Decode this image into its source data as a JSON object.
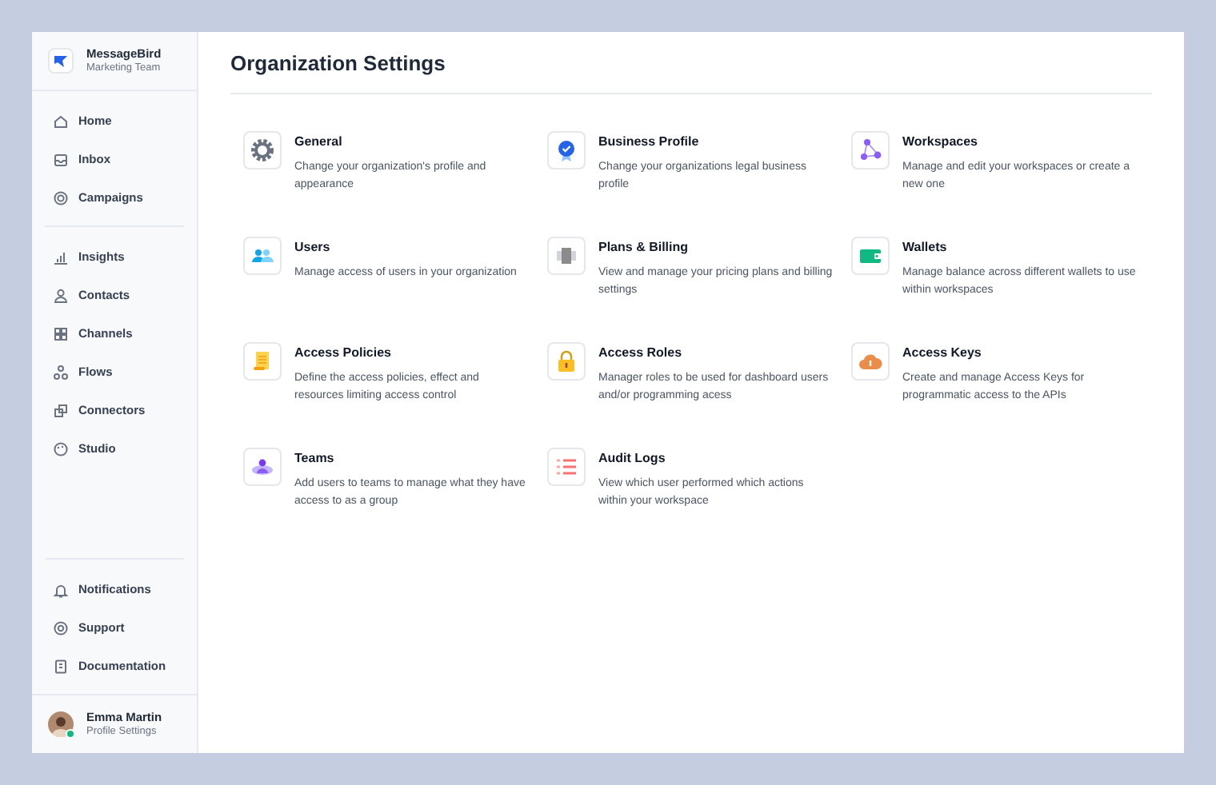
{
  "brand": {
    "name": "MessageBird",
    "team": "Marketing Team"
  },
  "nav_groups": [
    {
      "items": [
        {
          "label": "Home",
          "kind": "home"
        },
        {
          "label": "Inbox",
          "kind": "inbox"
        },
        {
          "label": "Campaigns",
          "kind": "campaigns"
        }
      ]
    },
    {
      "items": [
        {
          "label": "Insights",
          "kind": "insights"
        },
        {
          "label": "Contacts",
          "kind": "contacts"
        },
        {
          "label": "Channels",
          "kind": "channels"
        },
        {
          "label": "Flows",
          "kind": "flows"
        },
        {
          "label": "Connectors",
          "kind": "connectors"
        },
        {
          "label": "Studio",
          "kind": "studio"
        }
      ]
    }
  ],
  "bottom_nav": [
    {
      "label": "Notifications",
      "kind": "bell"
    },
    {
      "label": "Support",
      "kind": "support"
    },
    {
      "label": "Documentation",
      "kind": "docs"
    }
  ],
  "user": {
    "name": "Emma Martin",
    "subtitle": "Profile Settings",
    "online": true
  },
  "page_title": "Organization Settings",
  "settings": [
    {
      "title": "General",
      "description": "Change your organization's profile and appearance",
      "kind": "gear"
    },
    {
      "title": "Business Profile",
      "description": "Change your organizations legal business profile",
      "kind": "badge"
    },
    {
      "title": "Workspaces",
      "description": "Manage and edit your workspaces or create a new one",
      "kind": "nodes"
    },
    {
      "title": "Users",
      "description": "Manage access of users in your organization",
      "kind": "users"
    },
    {
      "title": "Plans & Billing",
      "description": "View and manage your pricing plans and billing settings",
      "kind": "plans"
    },
    {
      "title": "Wallets",
      "description": "Manage balance across different wallets to use within workspaces",
      "kind": "wallet"
    },
    {
      "title": "Access Policies",
      "description": "Define the access policies, effect and resources limiting access control",
      "kind": "scroll"
    },
    {
      "title": "Access Roles",
      "description": "Manager roles to be used for dashboard users and/or programming acess",
      "kind": "lock"
    },
    {
      "title": "Access Keys",
      "description": "Create and manage Access Keys for programmatic access to the APIs",
      "kind": "cloud"
    },
    {
      "title": "Teams",
      "description": "Add users to teams to manage what they have access to as a group",
      "kind": "team"
    },
    {
      "title": "Audit Logs",
      "description": "View which user performed which actions within your workspace",
      "kind": "list"
    }
  ]
}
